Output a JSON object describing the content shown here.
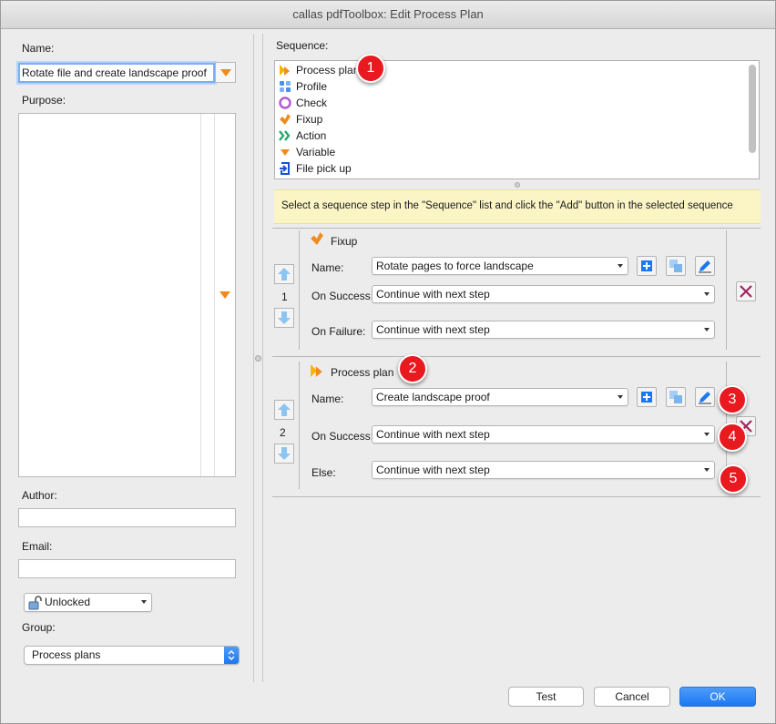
{
  "window": {
    "title": "callas pdfToolbox: Edit Process Plan"
  },
  "left": {
    "name_label": "Name:",
    "name_value": "Rotate file and create landscape proof",
    "purpose_label": "Purpose:",
    "purpose_value": "",
    "author_label": "Author:",
    "author_value": "",
    "email_label": "Email:",
    "email_value": "",
    "lock_value": "Unlocked",
    "group_label": "Group:",
    "group_value": "Process plans"
  },
  "sequence": {
    "label": "Sequence:",
    "items": [
      {
        "label": "Process plan",
        "icon": "process-plan-icon"
      },
      {
        "label": "Profile",
        "icon": "profile-icon"
      },
      {
        "label": "Check",
        "icon": "check-icon"
      },
      {
        "label": "Fixup",
        "icon": "fixup-icon"
      },
      {
        "label": "Action",
        "icon": "action-icon"
      },
      {
        "label": "Variable",
        "icon": "variable-icon"
      },
      {
        "label": "File pick up",
        "icon": "file-pick-up-icon"
      }
    ],
    "hint": "Select a sequence step in the \"Sequence\" list and click the \"Add\" button in the selected sequence"
  },
  "steps": [
    {
      "number": "1",
      "type": "Fixup",
      "name_label": "Name:",
      "name_value": "Rotate pages to force landscape",
      "success_label": "On Success:",
      "success_value": "Continue with next step",
      "failure_label": "On Failure:",
      "failure_value": "Continue with next step"
    },
    {
      "number": "2",
      "type": "Process plan",
      "name_label": "Name:",
      "name_value": "Create landscape proof",
      "success_label": "On Success:",
      "success_value": "Continue with next step",
      "failure_label": "Else:",
      "failure_value": "Continue with next step"
    }
  ],
  "callouts": [
    "1",
    "2",
    "3",
    "4",
    "5"
  ],
  "footer": {
    "test": "Test",
    "cancel": "Cancel",
    "ok": "OK"
  },
  "colors": {
    "accent": "#1a78f3",
    "callout": "#e8191f",
    "hint_bg": "#fbf5c5",
    "orange": "#f08a1c"
  }
}
